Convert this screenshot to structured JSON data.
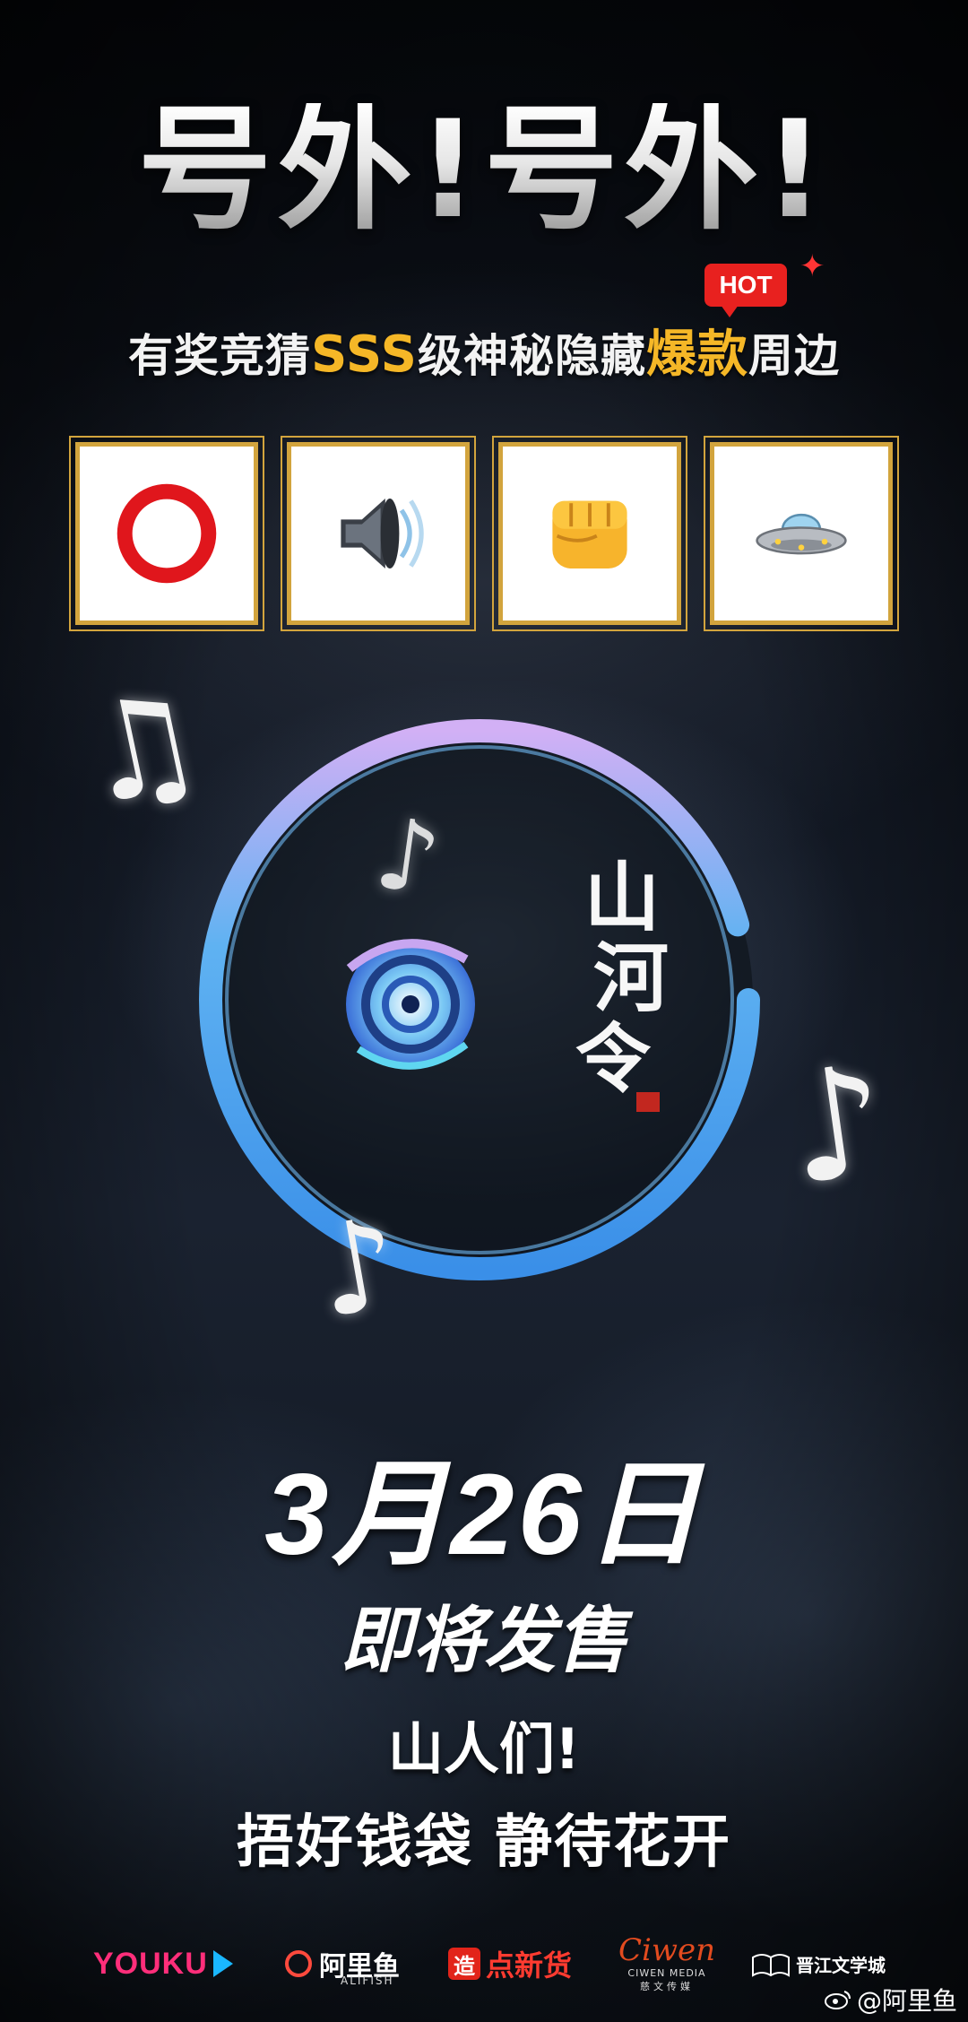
{
  "headline": "号外!号外!",
  "hot_badge": "HOT",
  "subtitle": {
    "part1": "有奖竞猜",
    "part2": "SSS",
    "part3": "级神秘隐藏",
    "part4": "爆款",
    "part5": "周边"
  },
  "emoji_clues": [
    "red-circle",
    "speaker",
    "fist",
    "ufo"
  ],
  "logo_text": {
    "vertical_title": [
      "山",
      "河",
      "令"
    ]
  },
  "date": "3月26日",
  "line2": "即将发售",
  "line3": "山人们!",
  "line4": "捂好钱袋  静待花开",
  "footer": {
    "youku": "YOUKU",
    "alifish": "阿里鱼",
    "alifish_sub": "ALIFISH",
    "dian_mark": "造",
    "dian_name": "点新货",
    "ciwen_script": "Ciwen",
    "ciwen_sub": "CIWEN MEDIA",
    "ciwen_cn": "慈文传媒",
    "jjwxc": "晋江文学城",
    "weibo": "@阿里鱼"
  },
  "colors": {
    "gold": "#f5b727",
    "hot_red": "#e8211f",
    "frame_gold": "#d2a43d",
    "ring_blue": "#4fa8f5",
    "ring_violet": "#c6a6f2"
  }
}
